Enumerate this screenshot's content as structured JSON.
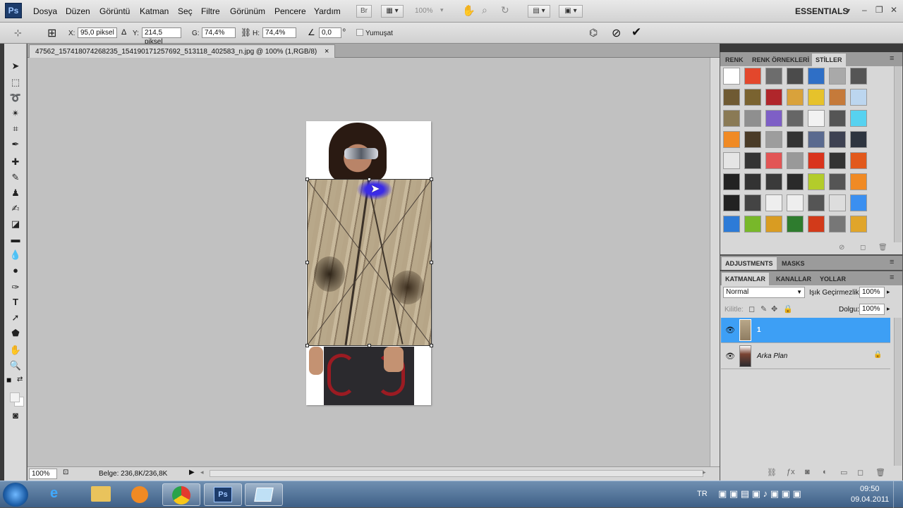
{
  "menubar": {
    "logo": "Ps",
    "items": [
      "Dosya",
      "Düzen",
      "Görüntü",
      "Katman",
      "Seç",
      "Filtre",
      "Görünüm",
      "Pencere",
      "Yardım"
    ],
    "bridge_label": "Br",
    "zoom_label": "100%",
    "workspace": "ESSENTIALS"
  },
  "options": {
    "x_label": "X:",
    "x_value": "95,0 piksel",
    "y_label": "Y:",
    "y_value": "214,5 piksel",
    "w_label": "G:",
    "w_value": "74,4%",
    "h_label": "H:",
    "h_value": "74,4%",
    "angle_value": "0,0",
    "angle_unit": "º",
    "antialias_label": "Yumuşat"
  },
  "document": {
    "tab_title": "47562_157418074268235_154190171257692_513118_402583_n.jpg @ 100% (1,RGB/8)",
    "close": "×"
  },
  "status": {
    "zoom": "100%",
    "doc_info": "Belge: 236,8K/236,8K"
  },
  "styles_panel": {
    "tabs": [
      "RENK",
      "RENK ÖRNEKLERİ",
      "STİLLER"
    ]
  },
  "adjustments_panel": {
    "tabs": [
      "ADJUSTMENTS",
      "MASKS"
    ]
  },
  "layers_panel": {
    "tabs": [
      "KATMANLAR",
      "KANALLAR",
      "YOLLAR"
    ],
    "blend_mode": "Normal",
    "opacity_label": "Işık Geçirmezlik:",
    "opacity_value": "100%",
    "lock_label": "Kilitle:",
    "fill_label": "Dolgu:",
    "fill_value": "100%",
    "layers": [
      {
        "name": "1",
        "selected": true
      },
      {
        "name": "Arka Plan",
        "selected": false
      }
    ]
  },
  "taskbar": {
    "lang": "TR",
    "time": "09:50",
    "date": "09.04.2011",
    "apps": [
      "ie-icon",
      "explorer-icon",
      "media-player-icon",
      "chrome-icon",
      "photoshop-icon",
      "app-icon"
    ]
  },
  "colors": {
    "layer_selected": "#3d9ff5",
    "canvas_bg": "#c1c1c1",
    "transform_box_border": "#333333"
  }
}
